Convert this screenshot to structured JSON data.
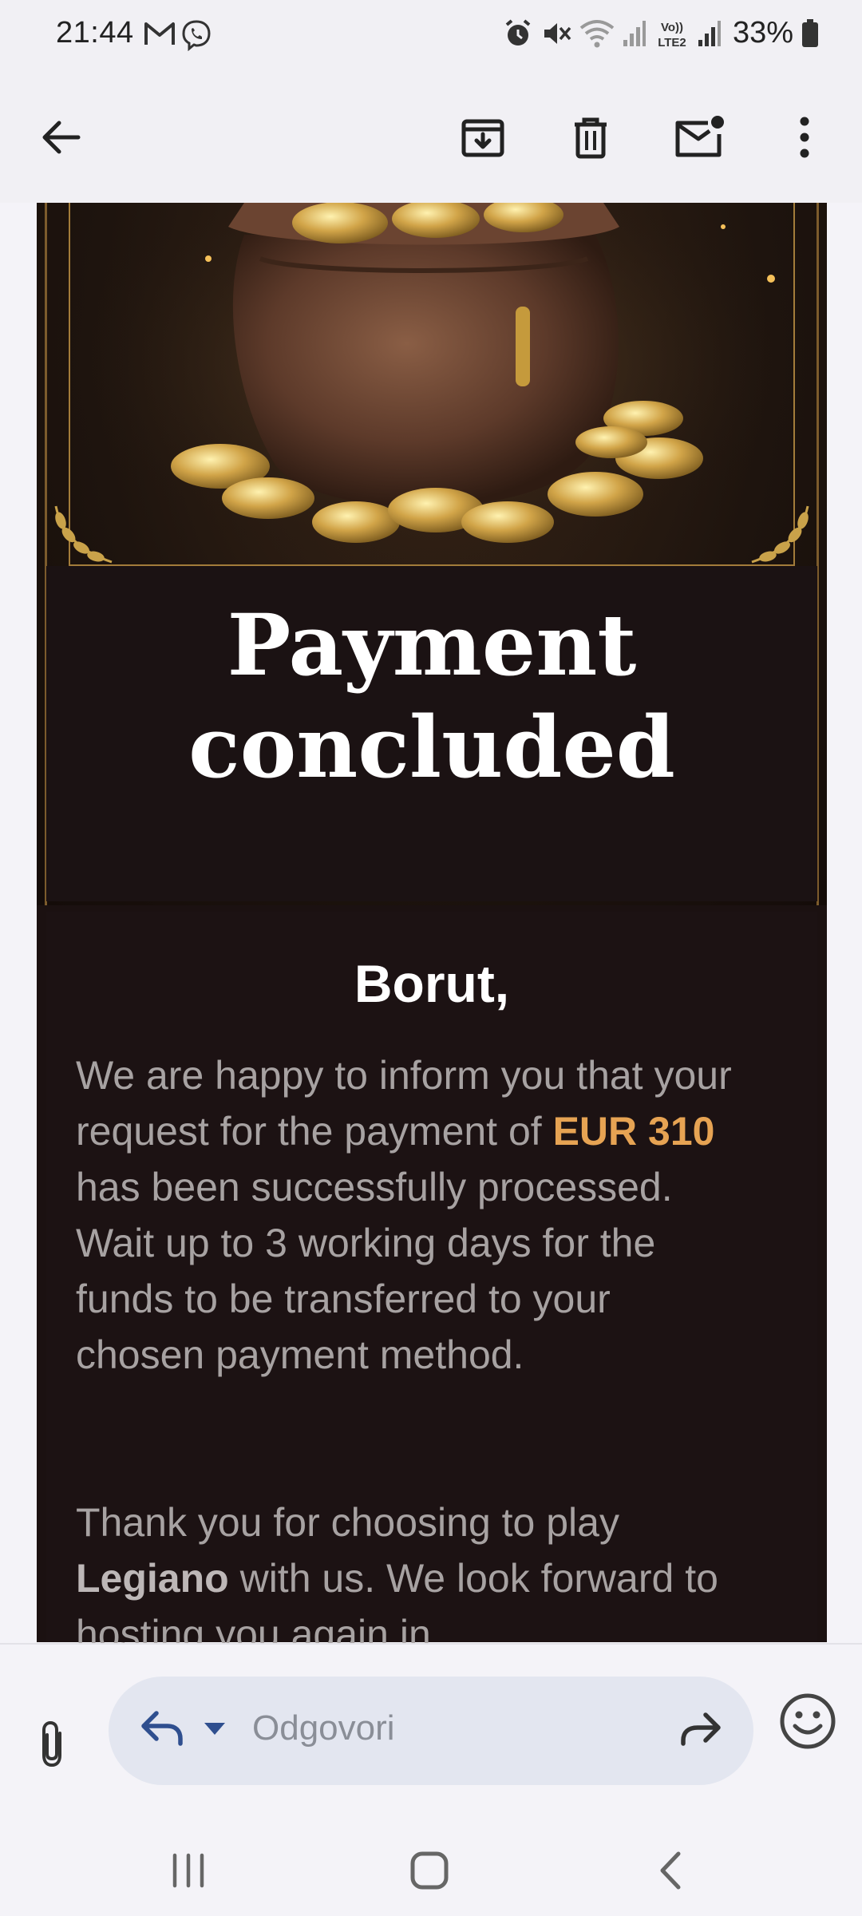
{
  "status_bar": {
    "time": "21:44",
    "battery": "33%",
    "left_icons": [
      "gmail-icon",
      "viber-icon"
    ],
    "right_icons": [
      "alarm-icon",
      "mute-icon",
      "wifi-icon",
      "signal-icon",
      "volte-icon",
      "signal-icon",
      "battery-icon"
    ],
    "volte_label": "Vo))\nLTE2"
  },
  "toolbar": {
    "icons": [
      "back-arrow-icon",
      "archive-icon",
      "delete-icon",
      "mark-unread-icon",
      "more-vert-icon"
    ]
  },
  "email": {
    "headline_line1": "Payment",
    "headline_line2": "concluded",
    "greeting": "Borut,",
    "p1_part1": "We are happy to inform you that your request for the payment of ",
    "p1_amount": "EUR 310",
    "p1_part2": " has been successfully processed. Wait up to 3 working days for the funds to be transferred to your chosen payment method.",
    "p2_part1": "Thank you for choosing to play ",
    "p2_brand": "Legiano",
    "p2_part2": " with us. We look forward to hosting you again in"
  },
  "reply_bar": {
    "placeholder": "Odgovori"
  },
  "colors": {
    "amount": "#e6a353",
    "email_bg": "#1b1111",
    "ui_bg": "#f4f3f8"
  }
}
